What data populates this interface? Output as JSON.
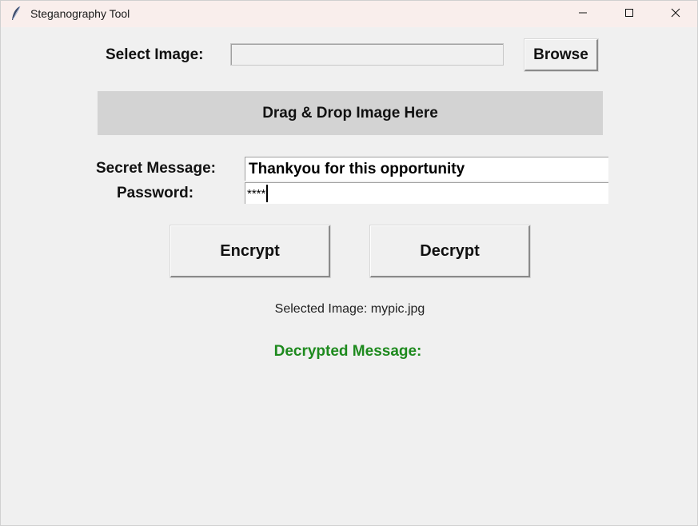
{
  "window": {
    "title": "Steganography Tool",
    "controls": {
      "minimize": "minimize-icon",
      "maximize": "maximize-icon",
      "close": "close-icon"
    },
    "app_icon": "feather-icon"
  },
  "select_image": {
    "label": "Select Image:",
    "path_value": "",
    "browse_label": "Browse"
  },
  "drop_zone": {
    "label": "Drag & Drop Image Here"
  },
  "secret_message": {
    "label": "Secret Message:",
    "value": "Thankyou for this opportunity"
  },
  "password": {
    "label": "Password:",
    "value": "****"
  },
  "actions": {
    "encrypt_label": "Encrypt",
    "decrypt_label": "Decrypt"
  },
  "status": {
    "selected_image_text": "Selected Image: mypic.jpg",
    "decrypted_label": "Decrypted Message:"
  },
  "colors": {
    "titlebar": "#f9eeec",
    "background": "#f0f0f0",
    "drop_zone": "#d3d3d3",
    "decrypted_label": "#1e8a1e"
  }
}
